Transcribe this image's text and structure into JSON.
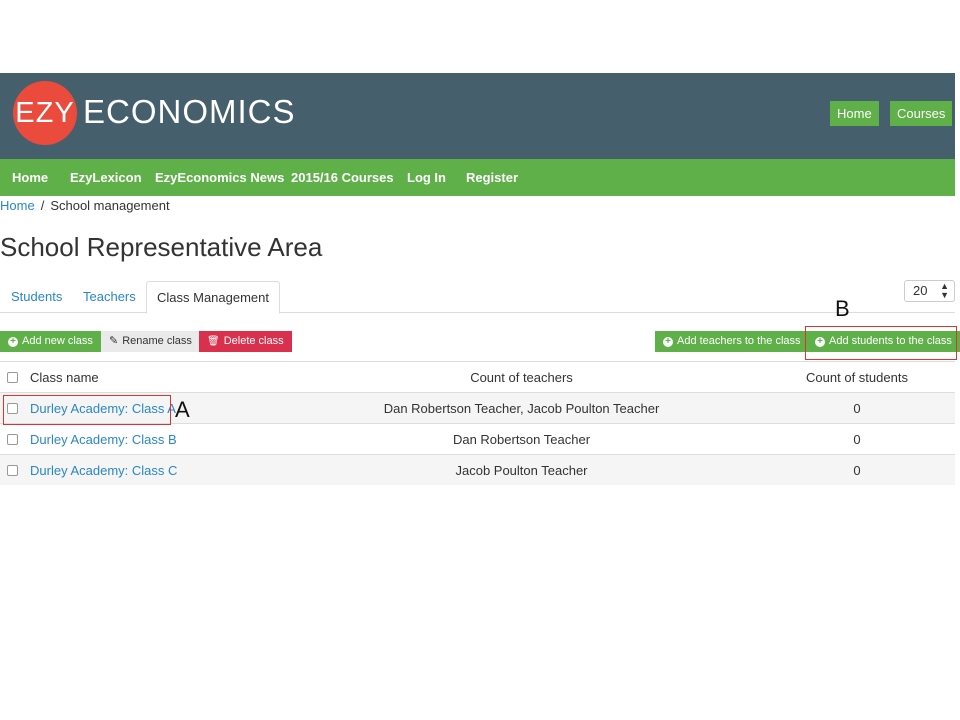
{
  "header": {
    "logo_left": "EZY",
    "logo_right": "ECONOMICS",
    "buttons": [
      "Home",
      "Courses"
    ]
  },
  "nav": {
    "items": [
      "Home",
      "EzyLexicon",
      "EzyEconomics News",
      "2015/16 Courses",
      "Log In",
      "Register"
    ]
  },
  "breadcrumb": {
    "home": "Home",
    "separator": "/",
    "current": "School management"
  },
  "page_title": "School Representative Area",
  "tabs": [
    "Students",
    "Teachers",
    "Class Management"
  ],
  "active_tab": "Class Management",
  "page_size": "20",
  "actions": {
    "add_new_class": "Add new class",
    "rename_class": "Rename class",
    "delete_class": "Delete class",
    "add_teachers": "Add teachers to the class",
    "add_students": "Add students to the class"
  },
  "table": {
    "headers": [
      "Class name",
      "Count of teachers",
      "Count of students"
    ],
    "rows": [
      {
        "name": "Durley Academy: Class A",
        "teachers": "Dan Robertson Teacher, Jacob Poulton Teacher",
        "students": "0"
      },
      {
        "name": "Durley Academy: Class B",
        "teachers": "Dan Robertson Teacher",
        "students": "0"
      },
      {
        "name": "Durley Academy: Class C",
        "teachers": "Jacob Poulton Teacher",
        "students": "0"
      }
    ]
  },
  "annotations": {
    "a": "A",
    "b": "B"
  },
  "colors": {
    "header_bg": "#465f6d",
    "accent_green": "#60b04a",
    "logo_red": "#ea4b3c",
    "link_blue": "#2a87c7",
    "delete_red": "#d9304d"
  }
}
